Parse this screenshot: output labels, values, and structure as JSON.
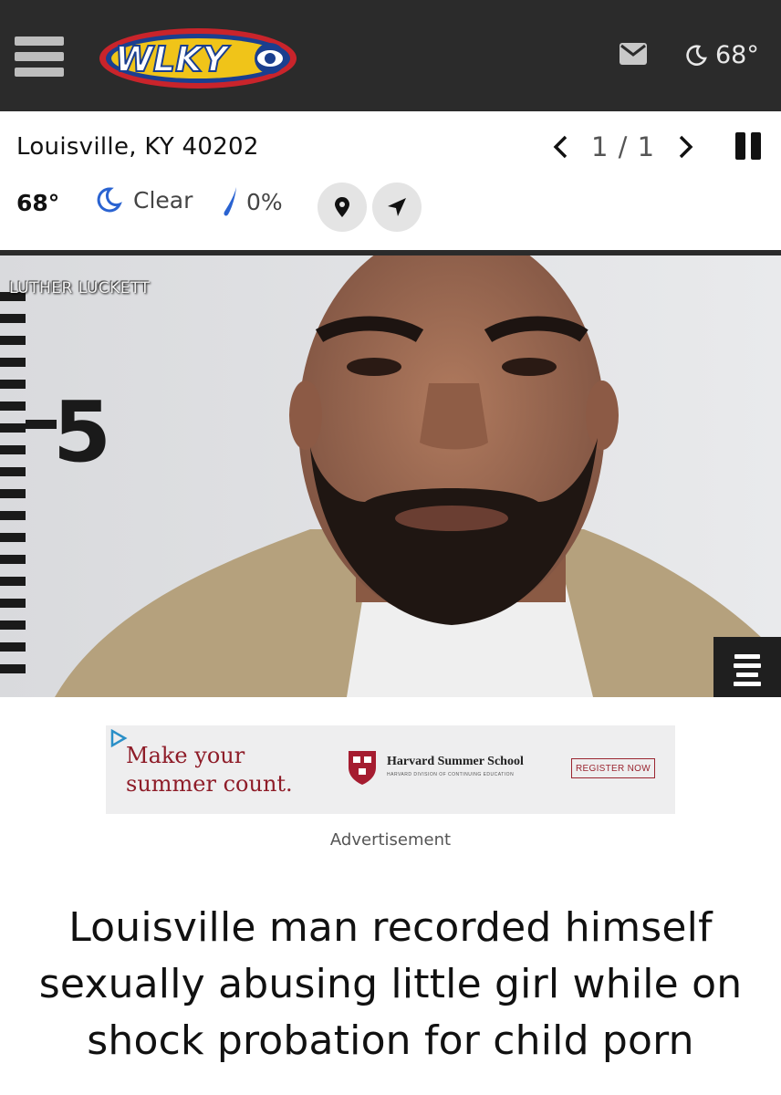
{
  "header": {
    "brand": "WLKY",
    "temperature": "68°"
  },
  "location": {
    "city": "Louisville, KY 40202",
    "pager": "1 / 1"
  },
  "weather": {
    "temperature": "68°",
    "condition": "Clear",
    "precipitation": "0%"
  },
  "photo": {
    "caption": "LUTHER LUCKETT",
    "ruler_number": "5"
  },
  "ad": {
    "headline_line1": "Make your",
    "headline_line2": "summer count.",
    "sponsor": "Harvard Summer School",
    "sponsor_sub": "HARVARD DIVISION OF CONTINUING EDUCATION",
    "cta": "REGISTER NOW",
    "label": "Advertisement"
  },
  "article": {
    "headline": "Louisville man recorded himself sexually abusing little girl while on shock probation for child porn"
  },
  "colors": {
    "header_bg": "#2b2b2b",
    "accent_blue": "#2a63d1",
    "ad_red": "#8e1c28"
  }
}
